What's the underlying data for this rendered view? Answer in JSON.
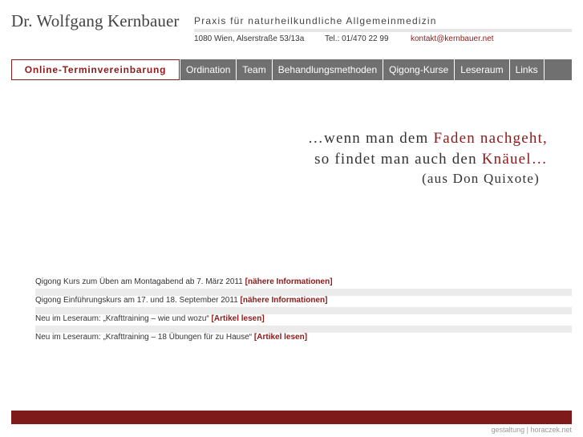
{
  "header": {
    "name": "Dr. Wolfgang Kernbauer",
    "subtitle": "Praxis für naturheilkundliche Allgemeinmedizin",
    "address": "1080 Wien, Alserstraße 53/13a",
    "phone": "Tel.: 01/470 22 99",
    "email": "kontakt@kernbauer.net"
  },
  "nav": {
    "items": [
      {
        "label": "Online-Terminvereinbarung"
      },
      {
        "label": "Ordination"
      },
      {
        "label": "Team"
      },
      {
        "label": "Behandlungsmethoden"
      },
      {
        "label": "Qigong-Kurse"
      },
      {
        "label": "Leseraum"
      },
      {
        "label": "Links"
      }
    ]
  },
  "quote": {
    "line1_pre": "…wenn man dem ",
    "line1_hl": "Faden nachgeht,",
    "line2_pre": "so findet man auch den ",
    "line2_hl": "Knäuel…",
    "source": "(aus Don Quixote)"
  },
  "news": [
    {
      "text": "Qigong Kurs zum Üben am Montagabend ab 7. März 2011 ",
      "link": "[nähere Informationen]"
    },
    {
      "text": "Qigong Einführungskurs am 17. und 18. September 2011 ",
      "link": "[nähere Informationen]"
    },
    {
      "text": "Neu im Leseraum: „Krafttraining – wie und wozu“ ",
      "link": "[Artikel lesen]"
    },
    {
      "text": "Neu im Leseraum: „Krafttraining – 18 Übungen für zu Hause“ ",
      "link": "[Artikel lesen]"
    }
  ],
  "footer": {
    "credit": "gestaltung | horaczek.net"
  },
  "colors": {
    "accent": "#8b1a1a",
    "nav_bg": "#707070",
    "footer_bar": "#7f1a1a"
  }
}
